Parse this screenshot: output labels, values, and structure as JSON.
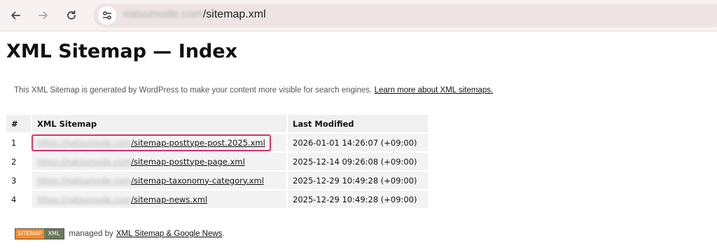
{
  "browser": {
    "url_host_blurred": "natsumode.com",
    "url_path": "/sitemap.xml"
  },
  "page": {
    "title": "XML Sitemap — Index",
    "intro_text": "This XML Sitemap is generated by WordPress to make your content more visible for search engines.",
    "intro_link": "Learn more about XML sitemaps."
  },
  "table": {
    "headers": [
      "#",
      "XML Sitemap",
      "Last Modified"
    ],
    "blurred_prefix": "https://natsumode.com",
    "rows": [
      {
        "num": "1",
        "path": "/sitemap-posttype-post.2025.xml",
        "modified": "2026-01-01 14:26:07 (+09:00)"
      },
      {
        "num": "2",
        "path": "/sitemap-posttype-page.xml",
        "modified": "2025-12-14 09:26:08 (+09:00)"
      },
      {
        "num": "3",
        "path": "/sitemap-taxonomy-category.xml",
        "modified": "2025-12-29 10:49:28 (+09:00)"
      },
      {
        "num": "4",
        "path": "/sitemap-news.xml",
        "modified": "2025-12-29 10:49:28 (+09:00)"
      }
    ]
  },
  "footer": {
    "badge_left": "SITEMAP",
    "badge_right": "XML",
    "managed_by": "managed by",
    "link": "XML Sitemap & Google News",
    "period": "."
  },
  "colors": {
    "highlight": "#e0306a",
    "toolbar_bg": "#f7f1f1",
    "address_bg": "#eee4e4"
  }
}
